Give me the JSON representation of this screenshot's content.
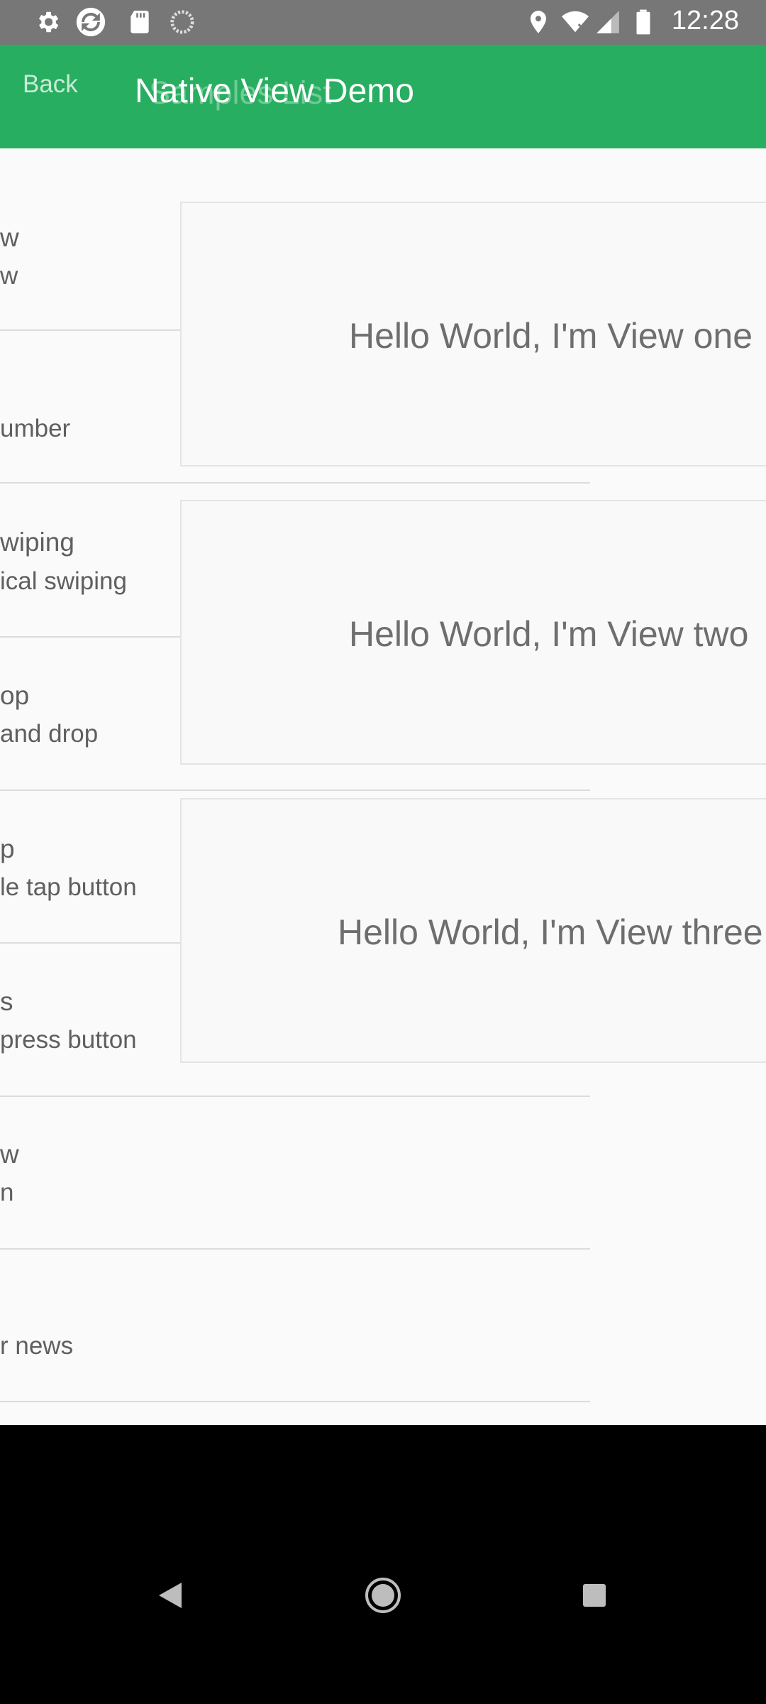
{
  "status_bar": {
    "time": "12:28",
    "icons": [
      "settings-icon",
      "sync-icon",
      "sd-card-icon",
      "loading-icon",
      "location-icon",
      "wifi-icon",
      "signal-icon",
      "battery-icon"
    ]
  },
  "app_bar": {
    "back_label": "Back",
    "title": "Native View Demo",
    "previous_title_ghost": "Samples List",
    "color": "#27ae60"
  },
  "list_items": [
    {
      "line1": "w",
      "line2": "w"
    },
    {
      "line1": "",
      "line2": "umber"
    },
    {
      "line1": "wiping",
      "line2": "ical swiping"
    },
    {
      "line1": "op",
      "line2": "and drop"
    },
    {
      "line1": "p",
      "line2": "le tap button"
    },
    {
      "line1": "s",
      "line2": "press button"
    },
    {
      "line1": "w",
      "line2": "n"
    },
    {
      "line1": "",
      "line2": "r news"
    }
  ],
  "native_views": [
    {
      "text": "Hello World, I'm View one"
    },
    {
      "text": "Hello World, I'm View two"
    },
    {
      "text": "Hello World, I'm View three"
    }
  ],
  "nav_bar": {
    "icons": [
      "back-triangle-icon",
      "home-circle-icon",
      "recents-square-icon"
    ]
  }
}
